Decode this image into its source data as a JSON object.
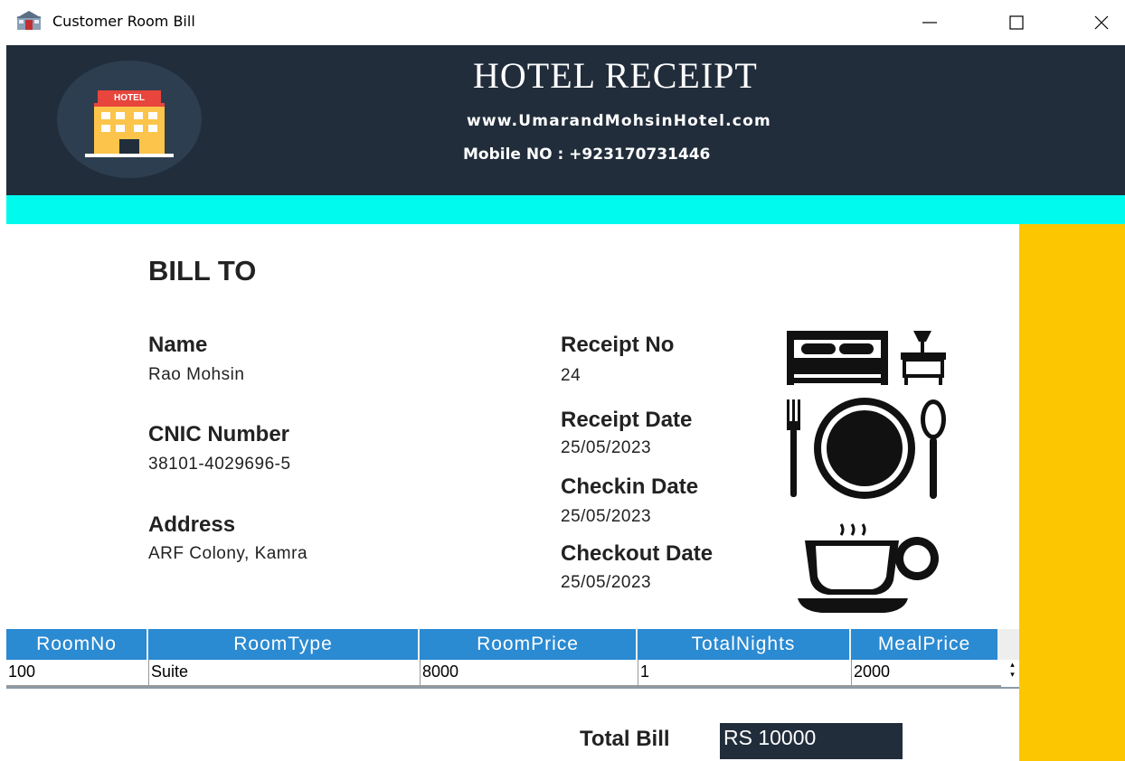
{
  "window": {
    "title": "Customer Room Bill"
  },
  "header": {
    "title": "HOTEL RECEIPT",
    "website": "www.UmarandMohsinHotel.com",
    "mobile": "Mobile NO : +923170731446",
    "logo_text": "HOTEL"
  },
  "bill": {
    "heading": "BILL TO",
    "name_label": "Name",
    "name_value": "Rao Mohsin",
    "cnic_label": "CNIC Number",
    "cnic_value": "38101-4029696-5",
    "address_label": "Address",
    "address_value": "ARF Colony, Kamra",
    "receipt_no_label": "Receipt No",
    "receipt_no_value": "24",
    "receipt_date_label": "Receipt Date",
    "receipt_date_value": "25/05/2023",
    "checkin_label": "Checkin Date",
    "checkin_value": "25/05/2023",
    "checkout_label": "Checkout Date",
    "checkout_value": "25/05/2023"
  },
  "table": {
    "columns": [
      "RoomNo",
      "RoomType",
      "RoomPrice",
      "TotalNights",
      "MealPrice"
    ],
    "rows": [
      [
        "100",
        "Suite",
        "8000",
        "1",
        "2000"
      ]
    ]
  },
  "total": {
    "label": "Total Bill",
    "value": "RS 10000"
  },
  "icons": {
    "app": "hotel-app-icon",
    "logo": "hotel-building-icon",
    "room": "bed-lamp-icon",
    "meal": "plate-cutlery-icon",
    "tea": "tea-cup-icon"
  },
  "colors": {
    "header_bg": "#212d3b",
    "cyan_bar": "#00fbee",
    "gold_bar": "#fcc600",
    "table_header": "#2a8ad2"
  }
}
